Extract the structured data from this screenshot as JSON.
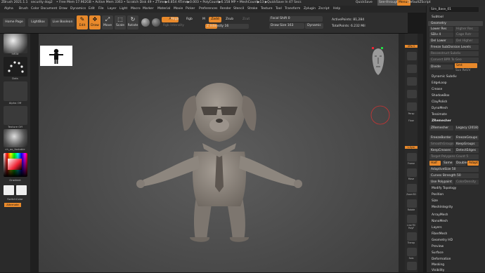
{
  "titlebar": {
    "app": "ZBrush 2021.1.1",
    "doc": "security dog2",
    "stats": "• Free Mem 17.962GB • Active Mem 3363 • Scratch Disk 49 • ZTime▶6.854 ATime▶0.003 • PolyCount▶6.158 MP • MeshCount▶13 ▶QuickSave In 47 Secs",
    "quicksave": "QuickSave",
    "seethrough": "See-through 0",
    "menus": "Menus",
    "script": "DefaultZScript"
  },
  "menubar": [
    "Alpha",
    "Brush",
    "Color",
    "Document",
    "Draw",
    "Dynamics",
    "Edit",
    "File",
    "Layer",
    "Light",
    "Macro",
    "Marker",
    "Material",
    "Movie",
    "Picker",
    "Preferences",
    "Render",
    "Stencil",
    "Stroke",
    "Texture",
    "Tool",
    "Transform",
    "Zplugin",
    "Zscript",
    "Help"
  ],
  "toolbar": {
    "home": "Home Page",
    "lightbox": "LightBox",
    "livebool": "Live Boolean",
    "edit": "Edit",
    "draw": "Draw",
    "move": "Move",
    "scale": "Scale",
    "rotate": "Rotate",
    "a_label": "A",
    "mrgb": "Mrgb",
    "rgb": "Rgb",
    "rgb_intensity": "Rgb Intensity",
    "m": "M",
    "zadd": "Zadd",
    "zsub": "Zsub",
    "zcut": "Zcut",
    "z_intensity": "Z Intensity 16",
    "focal": "Focal Shift 0",
    "drawsize": "Draw Size 163",
    "dynamic": "Dynamic",
    "activepoints": "ActivePoints: 81,284",
    "totalpoints": "TotalPoints: 6.232 Mil"
  },
  "left": {
    "brush": "InflAt",
    "stroke": "Dots",
    "alpha": "Alpha Off",
    "texture": "Texture Off",
    "material": "ch_ao_fastable",
    "gradient": "Gradient",
    "switch": "SwitchColor",
    "alternate": "Alternate"
  },
  "righttools": [
    "SPix 3",
    "Persp",
    "Floor",
    "L.Sym",
    "Frame",
    "Move",
    "Zoom3D",
    "Rotate",
    "Line Fill PolyF",
    "Transp",
    "Solo",
    "Xpose"
  ],
  "rpanel": {
    "search": "Sim_Base_01",
    "subtool": "Subtool",
    "geometry": "Geometry",
    "items": [
      {
        "a": "Lower Res",
        "b": "Higher Res"
      },
      {
        "a": "SDiv 4",
        "b": "Cage   Rstr"
      },
      {
        "a": "Del Lower",
        "b": "Del Higher"
      },
      {
        "a": "Freeze SubDivision Levels",
        "b": ""
      },
      {
        "a": "Reconstruct Subdiv",
        "b": ""
      },
      {
        "a": "Convert BPR To Geo",
        "b": ""
      },
      {
        "a": "Divide",
        "b": "Smt"
      },
      {
        "a": "",
        "b": "Suv   ReUV"
      }
    ],
    "list1": [
      "Dynamic Subdiv",
      "EdgeLoop",
      "Crease",
      "ShadowBox",
      "ClayPolish",
      "DynaMesh",
      "Tessimate",
      "ZRemesher"
    ],
    "zremesher": "ZRemesher",
    "legacy": "Legacy (2018)",
    "freezeborder": "FreezeBorder",
    "freezegroups": "FreezeGroups",
    "smoothgroups": "SmoothGroups",
    "keepgroups": "KeepGroups",
    "keepcreases": "KeepCreases",
    "detectedges": "DetectEdges",
    "targetpoly": "Target Polygons Count 5",
    "half": "Half",
    "same": "Same",
    "double": "Double",
    "adapt": "Adapt",
    "adaptive": "AdaptiveSize 50",
    "curves": "Curves Strength 50",
    "usepoly": "Use Polypaint",
    "colordensity": "ColorDensity",
    "list2": [
      "Modify Topology",
      "Position",
      "Size",
      "MeshIntegrity"
    ],
    "list3": [
      "ArrayMesh",
      "NanoMesh",
      "Layers",
      "FiberMesh",
      "Geometry HD",
      "Preview",
      "Surface",
      "Deformation",
      "Masking",
      "Visibility"
    ]
  }
}
